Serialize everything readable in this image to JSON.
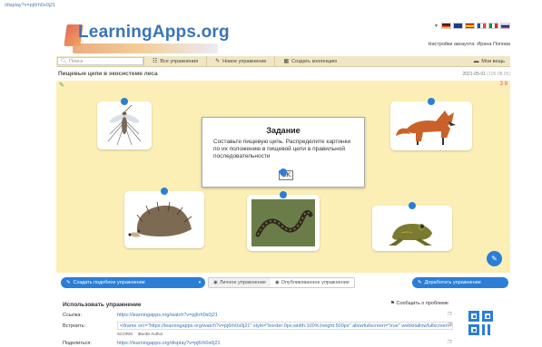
{
  "browser": {
    "url": "/display?v=pj6rh0s0j21"
  },
  "header": {
    "logo_text": "LearningApps.org",
    "account_label": "Настройки аккаунта: Ирина Попова"
  },
  "nav": {
    "search_placeholder": "Поиск",
    "all_exercises": "Все упражнения",
    "new_exercise": "Новое упражнение",
    "create_collection": "Создать коллекцию",
    "my_apps": "Мои вещь"
  },
  "page": {
    "title": "Пищевые цепи в экосистеме леса",
    "date": "2021-05-01",
    "date_extra": "(105 08.05)"
  },
  "board": {
    "counter": "3 9",
    "dialog_title": "Задание",
    "dialog_text": "Составьте пищевую цепь. Распределите картинки по их положению в пищевой цепи в правильной последовательности",
    "ok_label": "OK"
  },
  "actions": {
    "create_similar": "Создать подобное упражнение",
    "personal": "Личное упражнение",
    "published": "Опубликованное упражнение",
    "improve": "Доработать упражнение"
  },
  "use": {
    "title": "Использовать упражнение",
    "report": "Сообщить о проблеме",
    "link_label": "Ссылка:",
    "link_value": "https://learningapps.org/watch?v=pj6rh0s0j21",
    "embed_label": "Встроить:",
    "embed_value": "<iframe src=\"https://learningapps.org/watch?v=pj6rh0s0j21\" style=\"border:0px;width:100%;height:500px\" allowfullscreen=\"true\" webkitallowfullscreen=\"true\" mozallowfullscreen=\"true\"></iframe>",
    "scorm": "SCORM",
    "ibooks": "iBooks Author",
    "share_label": "Поделиться:",
    "share_value": "https://learningapps.org/display?v=pj6rh0s0j21"
  },
  "colors": {
    "accent": "#2a7ed6",
    "board_bg": "#fbefb6",
    "nav_bg": "#f0e6c5"
  }
}
